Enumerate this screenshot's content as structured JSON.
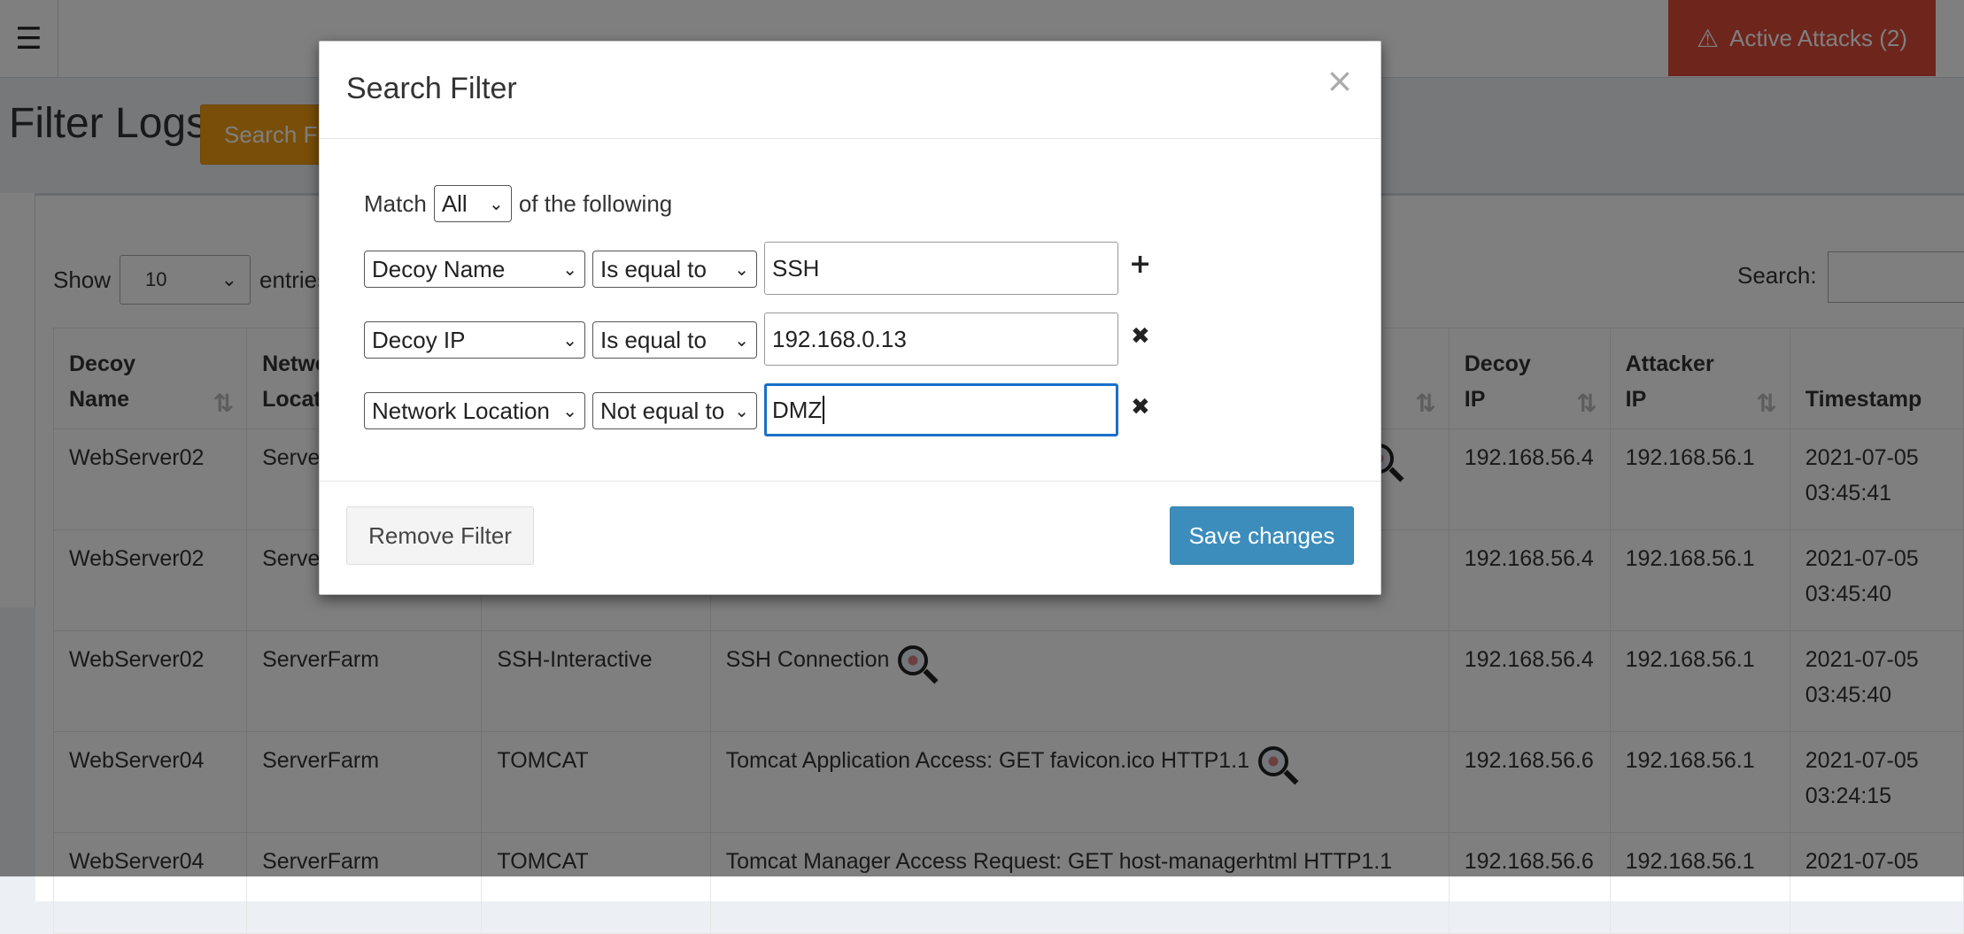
{
  "header": {
    "menu_icon": "hamburger-icon",
    "alert_icon": "warning-icon",
    "active_attacks_label": "Active Attacks (2)",
    "alert_color": "#dd4b39"
  },
  "page": {
    "title": "Filter Logs",
    "search_filters_button": "Search Filters"
  },
  "table_controls": {
    "show_label": "Show",
    "entries_value": "10",
    "entries_label": "entries",
    "search_label": "Search:"
  },
  "table": {
    "columns": [
      {
        "line1": "Decoy",
        "line2": "Name"
      },
      {
        "line1": "Network",
        "line2": "Location"
      },
      {
        "line1": "",
        "line2": ""
      },
      {
        "line1": "",
        "line2": ""
      },
      {
        "line1": "Decoy",
        "line2": "IP"
      },
      {
        "line1": "Attacker",
        "line2": "IP"
      },
      {
        "line1": "",
        "line2": "Timestamp"
      }
    ],
    "rows": [
      {
        "decoy_name": "WebServer02",
        "network_location": "ServerFarm",
        "service": "",
        "event": "",
        "decoy_ip": "192.168.56.4",
        "attacker_ip": "192.168.56.1",
        "date": "2021-07-05",
        "time": "03:45:41"
      },
      {
        "decoy_name": "WebServer02",
        "network_location": "ServerFarm",
        "service": "",
        "event": "",
        "decoy_ip": "192.168.56.4",
        "attacker_ip": "192.168.56.1",
        "date": "2021-07-05",
        "time": "03:45:40"
      },
      {
        "decoy_name": "WebServer02",
        "network_location": "ServerFarm",
        "service": "SSH-Interactive",
        "event": "SSH Connection",
        "decoy_ip": "192.168.56.4",
        "attacker_ip": "192.168.56.1",
        "date": "2021-07-05",
        "time": "03:45:40"
      },
      {
        "decoy_name": "WebServer04",
        "network_location": "ServerFarm",
        "service": "TOMCAT",
        "event": "Tomcat Application Access: GET favicon.ico HTTP1.1",
        "decoy_ip": "192.168.56.6",
        "attacker_ip": "192.168.56.1",
        "date": "2021-07-05",
        "time": "03:24:15"
      },
      {
        "decoy_name": "WebServer04",
        "network_location": "ServerFarm",
        "service": "TOMCAT",
        "event": "Tomcat Manager Access Request: GET host-managerhtml HTTP1.1",
        "decoy_ip": "192.168.56.6",
        "attacker_ip": "192.168.56.1",
        "date": "2021-07-05",
        "time": ""
      }
    ]
  },
  "modal": {
    "title": "Search Filter",
    "close_glyph": "×",
    "match_label": "Match",
    "match_value": "All",
    "match_suffix": "of the following",
    "filters": [
      {
        "field": "Decoy Name",
        "operator": "Is equal to",
        "value": "SSH",
        "action": "+",
        "action_icon": "plus-icon"
      },
      {
        "field": "Decoy IP",
        "operator": "Is equal to",
        "value": "192.168.0.13",
        "action": "✖",
        "action_icon": "remove-icon"
      },
      {
        "field": "Network Location",
        "operator": "Not equal to",
        "value": "DMZ",
        "action": "✖",
        "action_icon": "remove-icon"
      }
    ],
    "remove_button": "Remove Filter",
    "save_button": "Save changes",
    "save_color": "#3c8dbc"
  }
}
